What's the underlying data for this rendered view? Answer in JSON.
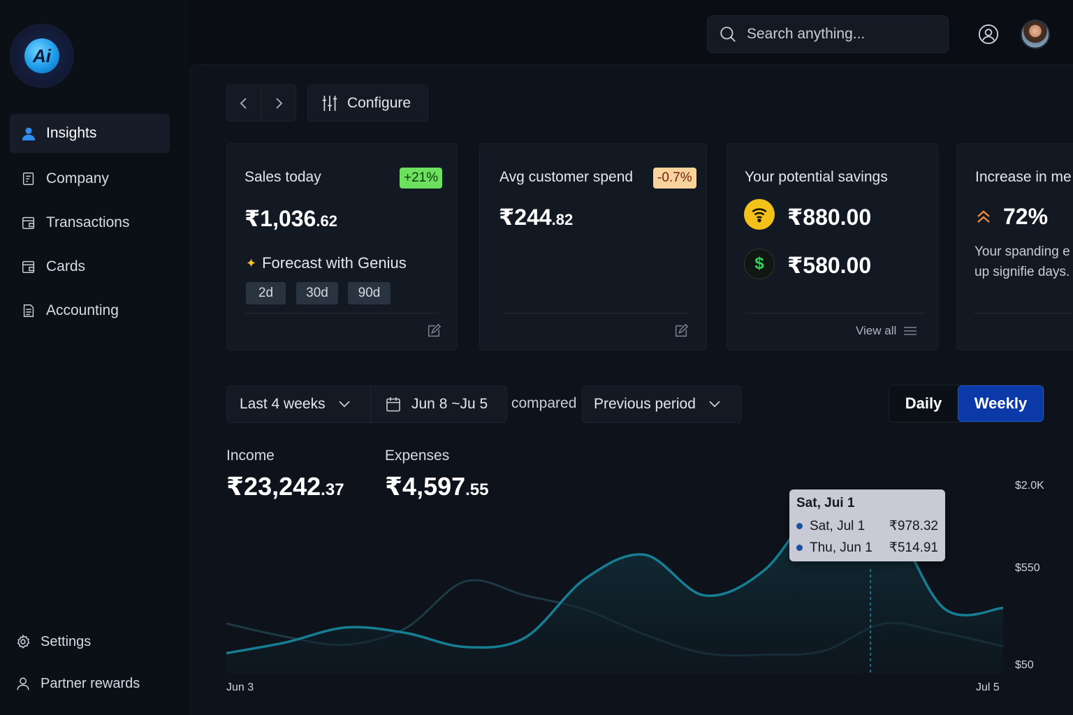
{
  "sidebar": {
    "logo_text": "Ai",
    "items": [
      {
        "label": "Insights",
        "icon": "person-icon"
      },
      {
        "label": "Company",
        "icon": "document-icon"
      },
      {
        "label": "Transactions",
        "icon": "wallet-icon"
      },
      {
        "label": "Cards",
        "icon": "card-icon"
      },
      {
        "label": "Accounting",
        "icon": "ledger-icon"
      }
    ],
    "bottom": [
      {
        "label": "Settings",
        "icon": "gear-icon"
      },
      {
        "label": "Partner rewards",
        "icon": "user-icon"
      }
    ]
  },
  "topbar": {
    "search_placeholder": "Search anything..."
  },
  "toolbar": {
    "configure_label": "Configure"
  },
  "cards": {
    "sales": {
      "title": "Sales today",
      "badge": "+21%",
      "value_main": "₹1,036",
      "value_dec": ".62",
      "forecast_label": "Forecast with Genius",
      "chips": [
        "2d",
        "30d",
        "90d"
      ]
    },
    "avg": {
      "title": "Avg customer spend",
      "badge": "-0.7%",
      "value_main": "₹244",
      "value_dec": ".82"
    },
    "savings": {
      "title": "Your potential savings",
      "value1": "₹880.00",
      "value2": "₹580.00",
      "view_all": "View all"
    },
    "increase": {
      "title": "Increase in me",
      "value": "72%",
      "desc": "Your spanding e gone up signifie days."
    }
  },
  "filters": {
    "range_label": "Last 4 weeks",
    "date_label": "Jun 8 ~Ju 5",
    "compared_label": "compared",
    "period_label": "Previous period",
    "toggle_daily": "Daily",
    "toggle_weekly": "Weekly"
  },
  "metrics": {
    "income_label": "Income",
    "income_main": "₹23,242",
    "income_dec": ".37",
    "expenses_label": "Expenses",
    "expenses_main": "₹4,597",
    "expenses_dec": ".55"
  },
  "tooltip": {
    "title": "Sat, Jui 1",
    "rows": [
      {
        "name": "Sat, Jul 1",
        "value": "₹978.32"
      },
      {
        "name": "Thu, Jun 1",
        "value": "₹514.91"
      }
    ]
  },
  "chart_data": {
    "type": "area",
    "xlabel": "",
    "ylabel": "",
    "x_ticks": [
      "Jun 3",
      "Jul 5"
    ],
    "y_ticks": [
      "$2.0K",
      "$550",
      "$50"
    ],
    "colors": {
      "current": "#167e93",
      "previous": "#1d3a44"
    },
    "series": [
      {
        "values": [
          40,
          180,
          370,
          300,
          120,
          240,
          990,
          1300,
          780,
          1100,
          2000,
          1890,
          620,
          620
        ]
      },
      {
        "values": [
          420,
          250,
          150,
          360,
          960,
          780,
          600,
          280,
          40,
          20,
          70,
          420,
          300,
          130
        ]
      }
    ]
  }
}
